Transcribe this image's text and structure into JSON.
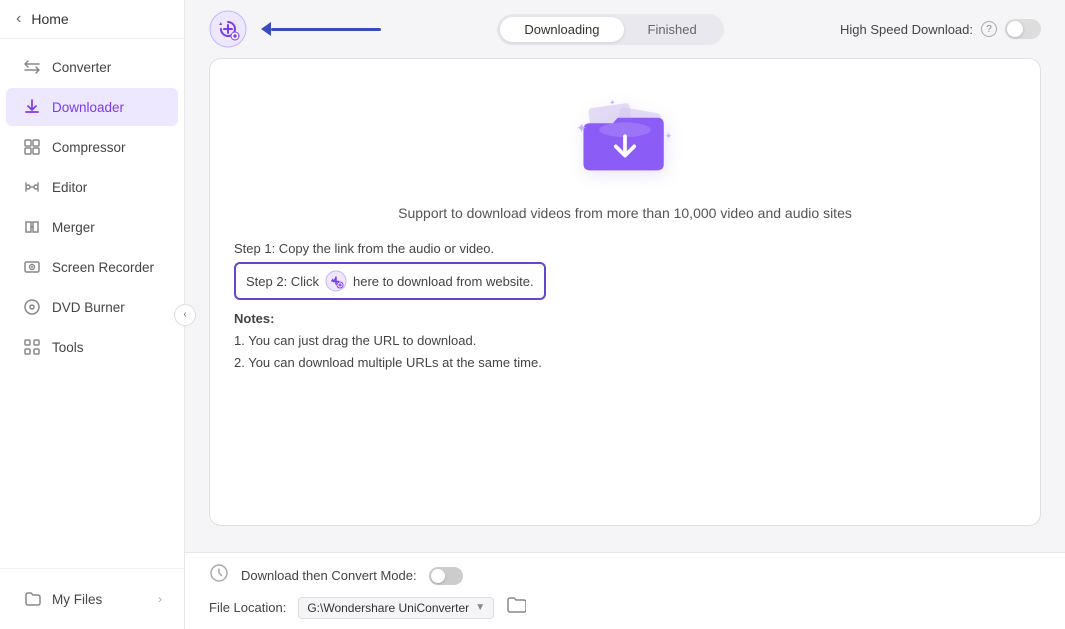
{
  "sidebar": {
    "home_label": "Home",
    "items": [
      {
        "id": "converter",
        "label": "Converter",
        "icon": "⇄"
      },
      {
        "id": "downloader",
        "label": "Downloader",
        "icon": "↓",
        "active": true
      },
      {
        "id": "compressor",
        "label": "Compressor",
        "icon": "⊞"
      },
      {
        "id": "editor",
        "label": "Editor",
        "icon": "✂"
      },
      {
        "id": "merger",
        "label": "Merger",
        "icon": "⊕"
      },
      {
        "id": "screen-recorder",
        "label": "Screen Recorder",
        "icon": "⊙"
      },
      {
        "id": "dvd-burner",
        "label": "DVD Burner",
        "icon": "⊙"
      },
      {
        "id": "tools",
        "label": "Tools",
        "icon": "⚙"
      }
    ],
    "bottom_items": [
      {
        "id": "my-files",
        "label": "My Files",
        "icon": "📁"
      }
    ]
  },
  "header": {
    "tab_downloading": "Downloading",
    "tab_finished": "Finished",
    "high_speed_label": "High Speed Download:",
    "help_icon": "?"
  },
  "main": {
    "support_text": "Support to download videos from more than 10,000 video and audio sites",
    "step1": "Step 1: Copy the link from the audio or video.",
    "step2_prefix": "Step 2: Click",
    "step2_suffix": "here to download from website.",
    "notes_title": "Notes:",
    "note1": "1. You can just drag the URL to download.",
    "note2": "2. You can download multiple URLs at the same time."
  },
  "bottombar": {
    "mode_label": "Download then Convert Mode:",
    "file_location_label": "File Location:",
    "file_path": "G:\\Wondershare UniConverter"
  }
}
